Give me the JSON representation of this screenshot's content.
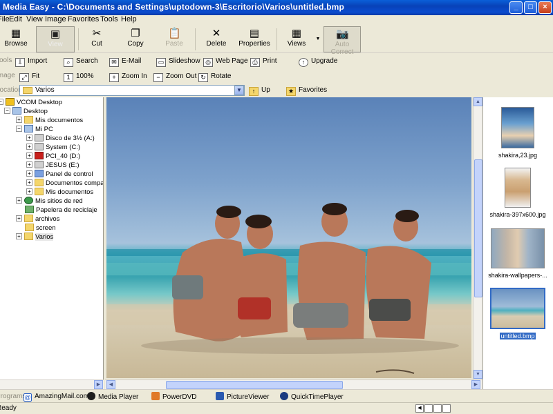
{
  "window": {
    "title": "Media Easy - C:\\Documents and Settings\\uptodown-3\\Escritorio\\Varios\\untitled.bmp",
    "minimize": "_",
    "maximize": "□",
    "close": "×"
  },
  "menu": [
    "File",
    "Edit",
    "View",
    "Image",
    "Favorites",
    "Tools",
    "Help"
  ],
  "toolbar": {
    "browse": "Browse",
    "view": "View",
    "cut": "Cut",
    "copy": "Copy",
    "paste": "Paste",
    "delete": "Delete",
    "properties": "Properties",
    "views": "Views",
    "auto_correct": "Auto Correct"
  },
  "tools_row": {
    "label": "Tools",
    "import": "Import",
    "search": "Search",
    "email": "E-Mail",
    "slideshow": "Slideshow",
    "webpage": "Web Page",
    "print": "Print",
    "upgrade": "Upgrade"
  },
  "image_row": {
    "label": "Image",
    "fit": "Fit",
    "zoom100": "100%",
    "zoomin": "Zoom In",
    "zoomout": "Zoom Out",
    "rotate": "Rotate"
  },
  "location": {
    "label": "Location",
    "value": "Varios",
    "up": "Up",
    "favorites": "Favorites"
  },
  "tree": [
    {
      "label": "VCOM Desktop",
      "icon": "vcom",
      "exp": "-",
      "indent": 0
    },
    {
      "label": "Desktop",
      "icon": "pc",
      "exp": "-",
      "indent": 1
    },
    {
      "label": "Mis documentos",
      "icon": "folder",
      "exp": "+",
      "indent": 2
    },
    {
      "label": "Mi PC",
      "icon": "pc",
      "exp": "-",
      "indent": 2
    },
    {
      "label": "Disco de 3½ (A:)",
      "icon": "drive",
      "exp": "+",
      "indent": 3
    },
    {
      "label": "System (C:)",
      "icon": "drive",
      "exp": "+",
      "indent": 3
    },
    {
      "label": "PCI_40 (D:)",
      "icon": "red",
      "exp": "+",
      "indent": 3
    },
    {
      "label": "JESUS (E:)",
      "icon": "drive",
      "exp": "+",
      "indent": 3
    },
    {
      "label": "Panel de control",
      "icon": "ctrl",
      "exp": "+",
      "indent": 3
    },
    {
      "label": "Documentos compart",
      "icon": "folder",
      "exp": "+",
      "indent": 3
    },
    {
      "label": "Mis documentos",
      "icon": "folder",
      "exp": "+",
      "indent": 3
    },
    {
      "label": "Mis sitios de red",
      "icon": "net",
      "exp": "+",
      "indent": 2
    },
    {
      "label": "Papelera de reciclaje",
      "icon": "bin",
      "exp": "",
      "indent": 2
    },
    {
      "label": "archivos",
      "icon": "folder",
      "exp": "+",
      "indent": 2
    },
    {
      "label": "screen",
      "icon": "folder",
      "exp": "",
      "indent": 2
    },
    {
      "label": "Varios",
      "icon": "folder",
      "exp": "+",
      "indent": 2,
      "selected": true
    }
  ],
  "thumbnails": [
    {
      "label": "shakira,23.jpg"
    },
    {
      "label": "shakira-397x600.jpg"
    },
    {
      "label": "shakira-wallpapers-..."
    },
    {
      "label": "untitled.bmp",
      "selected": true
    }
  ],
  "programs": {
    "label": "Programs",
    "items": [
      "AmazingMail.com",
      "Media Player",
      "PowerDVD",
      "PictureViewer",
      "QuickTimePlayer"
    ]
  },
  "status": {
    "text": "Ready"
  },
  "colors": {
    "titlebar": "#0842b8",
    "selection": "#316ac5",
    "chrome": "#ece9d8"
  }
}
